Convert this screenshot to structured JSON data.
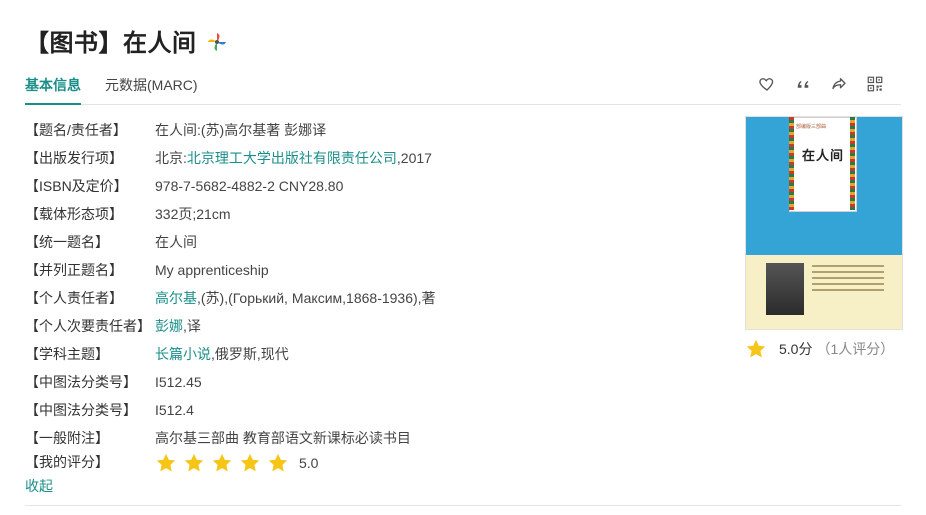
{
  "title": "【图书】在人间",
  "tabs": [
    {
      "label": "基本信息",
      "active": true
    },
    {
      "label": "元数据(MARC)",
      "active": false
    }
  ],
  "toolbar_icons": [
    "heart-icon",
    "quote-icon",
    "share-icon",
    "qrcode-icon"
  ],
  "rows": [
    {
      "label": "【题名/责任者】",
      "parts": [
        {
          "text": "在人间:(苏)高尔基著 彭娜译"
        }
      ]
    },
    {
      "label": "【出版发行项】",
      "parts": [
        {
          "text": "北京:"
        },
        {
          "text": "北京理工大学出版社有限责任公司",
          "link": true
        },
        {
          "text": ",2017"
        }
      ]
    },
    {
      "label": "【ISBN及定价】",
      "parts": [
        {
          "text": "978-7-5682-4882-2 CNY28.80"
        }
      ]
    },
    {
      "label": "【载体形态项】",
      "parts": [
        {
          "text": "332页;21cm"
        }
      ]
    },
    {
      "label": "【统一题名】",
      "parts": [
        {
          "text": "在人间"
        }
      ]
    },
    {
      "label": "【并列正题名】",
      "parts": [
        {
          "text": "My apprenticeship"
        }
      ]
    },
    {
      "label": "【个人责任者】",
      "parts": [
        {
          "text": "高尔基",
          "link": true
        },
        {
          "text": ",(苏),(Горький, Максим,1868-1936),著"
        }
      ]
    },
    {
      "label": "【个人次要责任者】",
      "parts": [
        {
          "text": "彭娜",
          "link": true
        },
        {
          "text": ",译"
        }
      ]
    },
    {
      "label": "【学科主题】",
      "parts": [
        {
          "text": "长篇小说",
          "link": true
        },
        {
          "text": ",俄罗斯,现代"
        }
      ]
    },
    {
      "label": "【中图法分类号】",
      "parts": [
        {
          "text": "I512.45"
        }
      ]
    },
    {
      "label": "【中图法分类号】",
      "parts": [
        {
          "text": "I512.4"
        }
      ]
    },
    {
      "label": "【一般附注】",
      "parts": [
        {
          "text": "高尔基三部曲 教育部语文新课标必读书目"
        }
      ]
    }
  ],
  "my_rating": {
    "label": "【我的评分】",
    "stars": 5,
    "max": 5,
    "score": "5.0"
  },
  "collapse_label": "收起",
  "cover": {
    "series": "部编版三部曲",
    "title": "在人间"
  },
  "side_rating": {
    "score": "5.0分",
    "count": "（1人评分）"
  },
  "colors": {
    "accent": "#1a8f8a",
    "star": "#f5c518"
  }
}
